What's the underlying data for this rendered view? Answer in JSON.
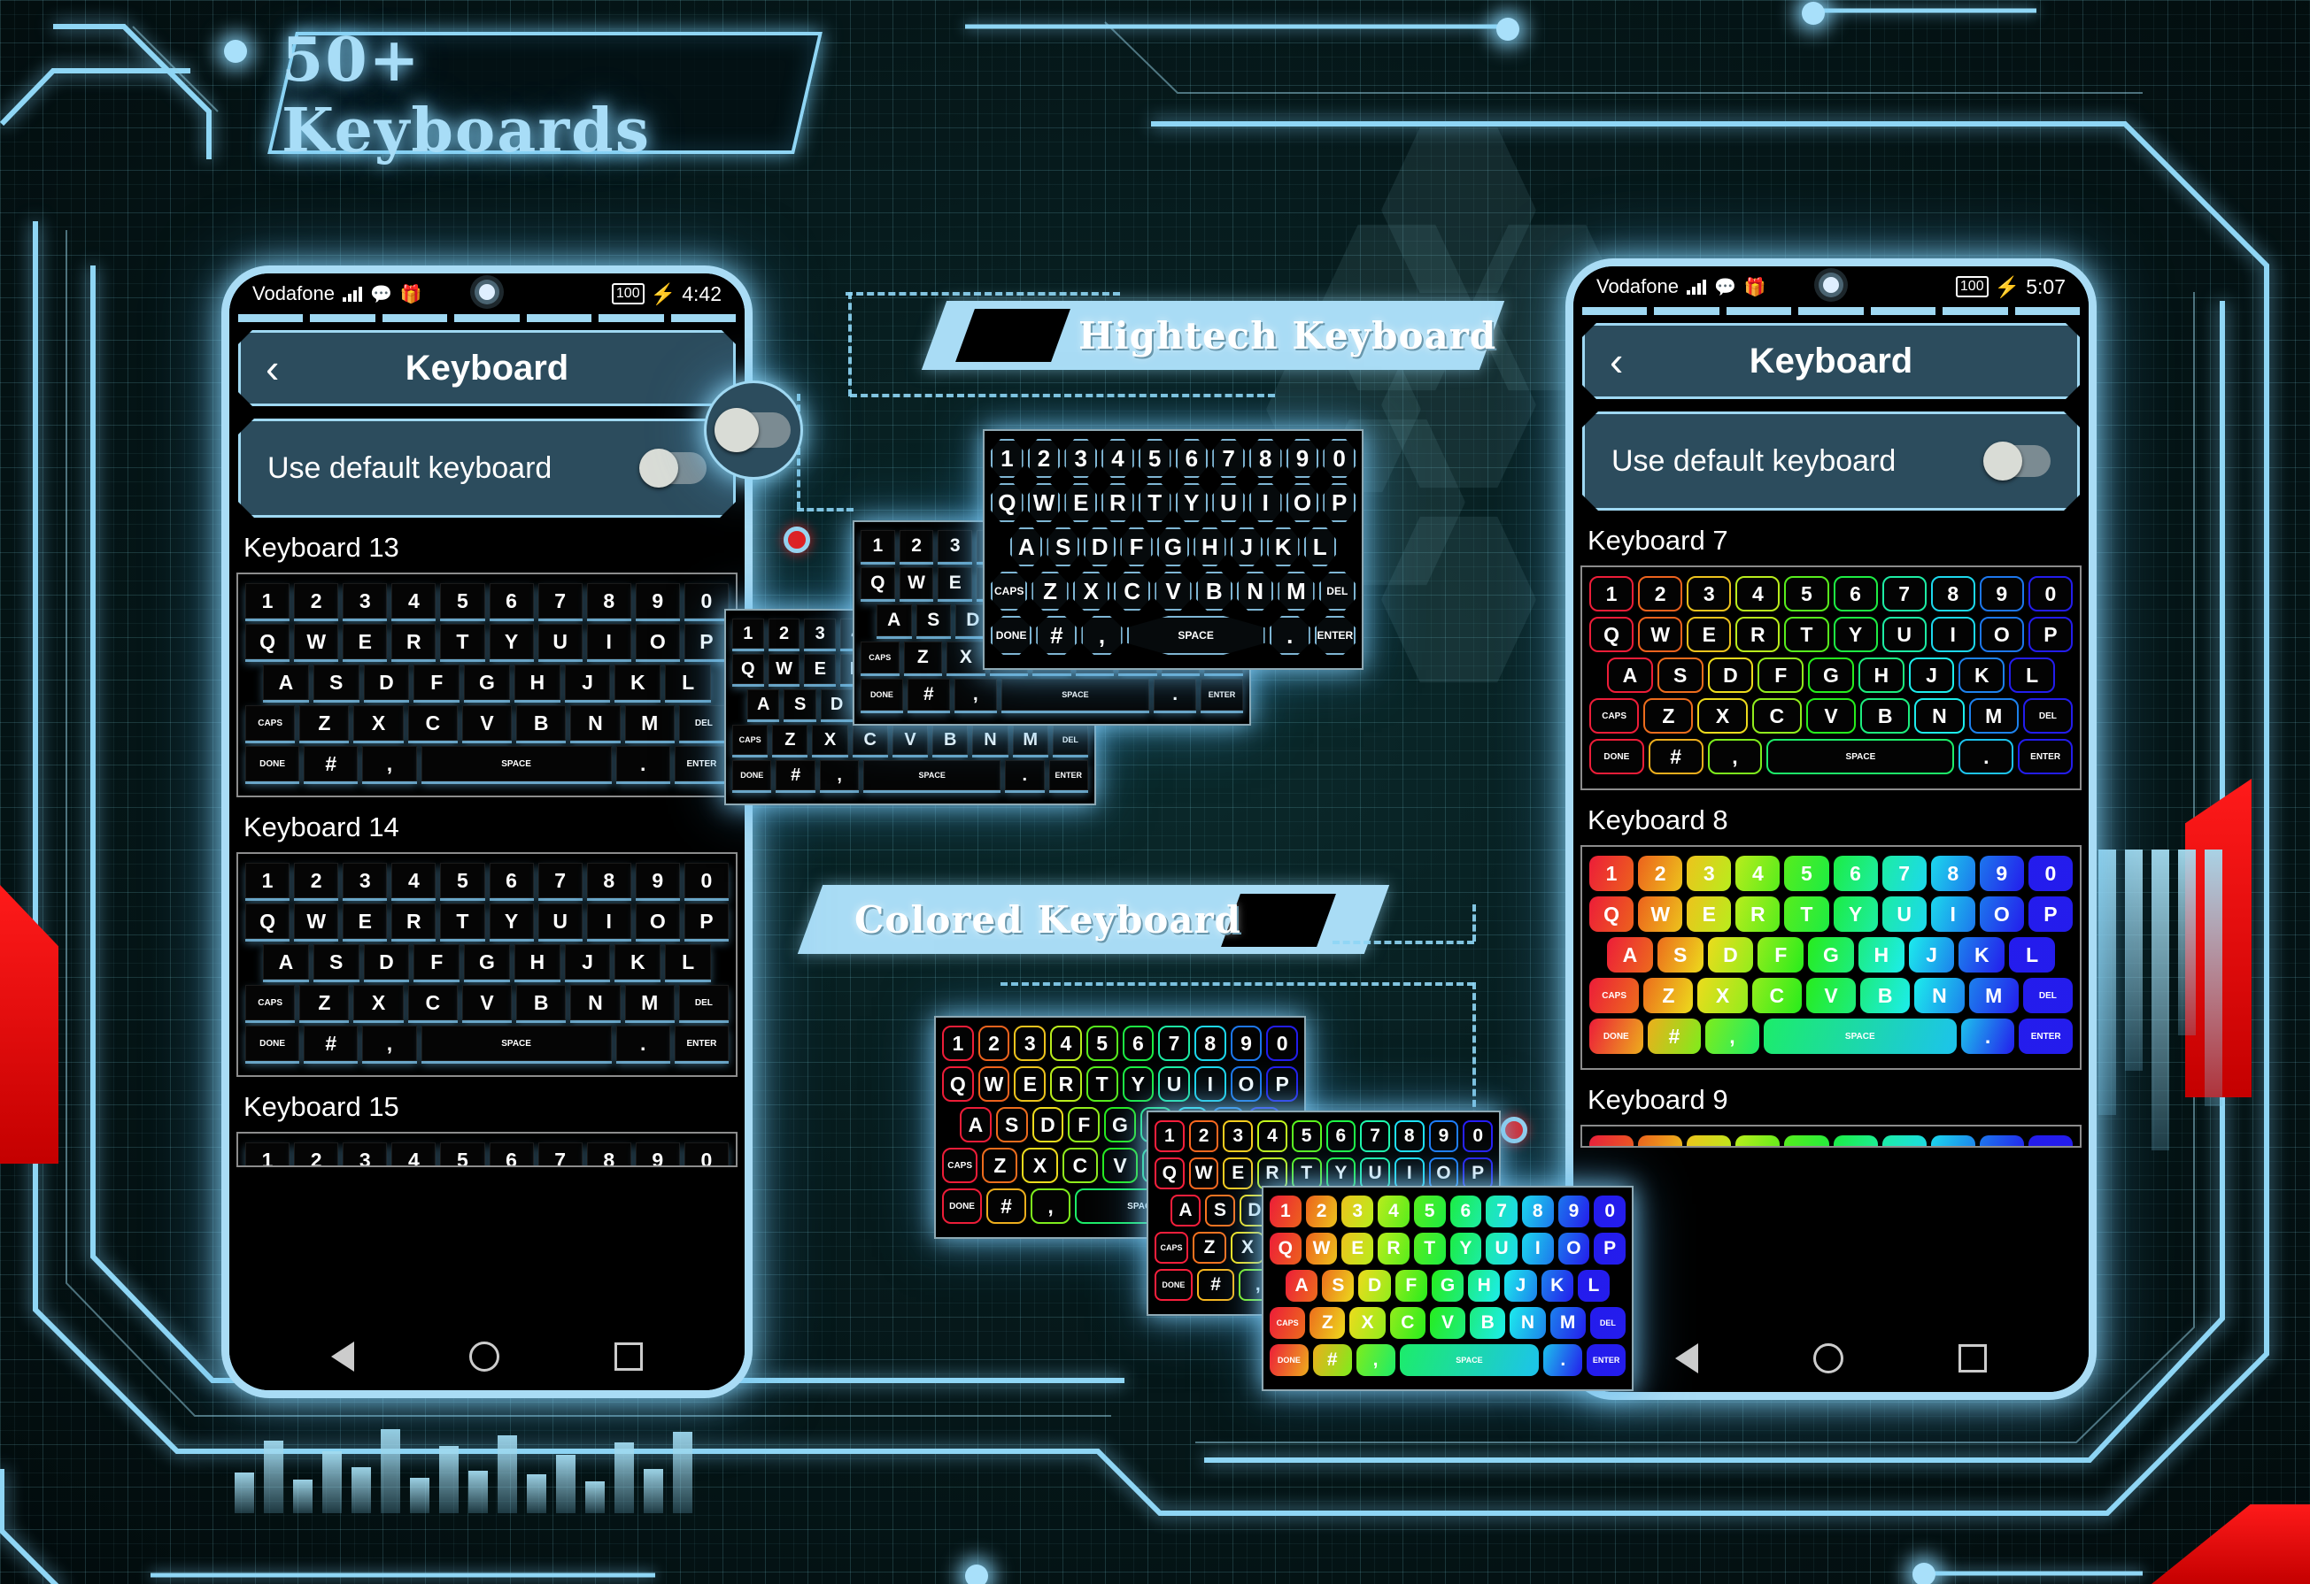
{
  "title": "50+ Keyboards",
  "banners": [
    {
      "label": "Hightech Keyboard"
    },
    {
      "label": "Colored Keyboard"
    }
  ],
  "keyboard_rows": {
    "digits": [
      "1",
      "2",
      "3",
      "4",
      "5",
      "6",
      "7",
      "8",
      "9",
      "0"
    ],
    "top": [
      "Q",
      "W",
      "E",
      "R",
      "T",
      "Y",
      "U",
      "I",
      "O",
      "P"
    ],
    "home": [
      "A",
      "S",
      "D",
      "F",
      "G",
      "H",
      "J",
      "K",
      "L"
    ],
    "bottom": [
      "CAPS",
      "Z",
      "X",
      "C",
      "V",
      "B",
      "N",
      "M",
      "DEL"
    ],
    "space": [
      "DONE",
      "#",
      ",",
      "SPACE",
      ".",
      "ENTER"
    ]
  },
  "phone_left": {
    "status": {
      "carrier": "Vodafone",
      "battery": "100",
      "charging": "⚡",
      "time": "4:42"
    },
    "appbar": {
      "back": "‹",
      "title": "Keyboard"
    },
    "pref": {
      "label": "Use default keyboard"
    },
    "sections": [
      {
        "label": "Keyboard 13",
        "style": "slab"
      },
      {
        "label": "Keyboard 14",
        "style": "slab"
      },
      {
        "label": "Keyboard 15",
        "style": "slab"
      }
    ],
    "nav": {
      "back": "back-triangle",
      "home": "home-circle",
      "recents": "recents-square"
    }
  },
  "phone_right": {
    "status": {
      "carrier": "Vodafone",
      "battery": "100",
      "charging": "⚡",
      "time": "5:07"
    },
    "appbar": {
      "back": "‹",
      "title": "Keyboard"
    },
    "pref": {
      "label": "Use default keyboard"
    },
    "sections": [
      {
        "label": "Keyboard 7",
        "style": "outline"
      },
      {
        "label": "Keyboard 8",
        "style": "fill"
      },
      {
        "label": "Keyboard 9",
        "style": "fill"
      }
    ],
    "nav": {
      "back": "back-triangle",
      "home": "home-circle",
      "recents": "recents-square"
    }
  },
  "colors": {
    "accent_blue": "#8fd6f5",
    "panel_blue": "#2c4c5d",
    "banner_blue": "#a9dcf5",
    "red_accent": "#ff1a1a",
    "background": "#061a1c",
    "rainbow": [
      "#e81123",
      "#e8117a",
      "#d411e8",
      "#b511e8",
      "#e84fb0",
      "#e89a4f",
      "#d4e811",
      "#8fe811",
      "#3de8a0",
      "#11c9e8",
      "#1170e8",
      "#1130e8"
    ]
  }
}
